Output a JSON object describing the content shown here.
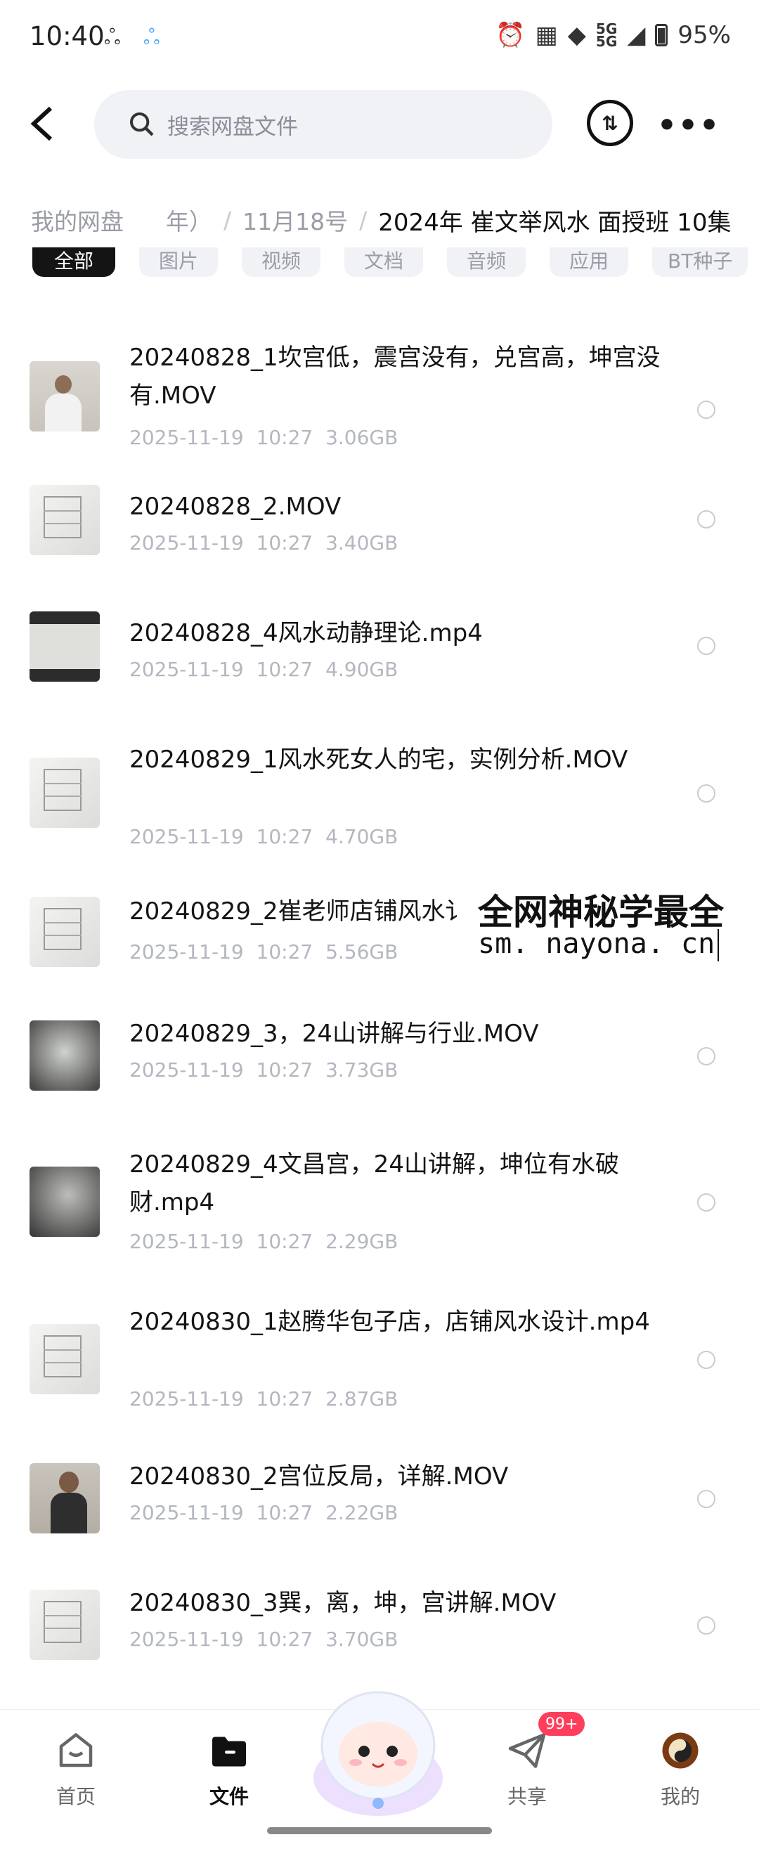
{
  "status_bar": {
    "time": "10:40",
    "signal": "5G",
    "battery": "95%"
  },
  "nav": {
    "search_placeholder": "搜索网盘文件"
  },
  "breadcrumb": {
    "root": "我的网盘",
    "partial": "年）",
    "middle": "11月18号",
    "current": "2024年 崔文举风水 面授班 10集"
  },
  "filters": [
    "全部",
    "图片",
    "视频",
    "文档",
    "音频",
    "应用",
    "BT种子"
  ],
  "files": [
    {
      "name": "20240828_1坎宫低，震宫没有，兑宫高，坤宫没有.MOV",
      "date": "2025-11-19",
      "time": "10:27",
      "size": "3.06GB",
      "thumb": "person"
    },
    {
      "name": "20240828_2.MOV",
      "date": "2025-11-19",
      "time": "10:27",
      "size": "3.40GB",
      "thumb": "board"
    },
    {
      "name": "20240828_4风水动静理论.mp4",
      "date": "2025-11-19",
      "time": "10:27",
      "size": "4.90GB",
      "thumb": "dark"
    },
    {
      "name": "20240829_1风水死女人的宅，实例分析.MOV",
      "date": "2025-11-19",
      "time": "10:27",
      "size": "4.70GB",
      "thumb": "board"
    },
    {
      "name": "20240829_2崔老师店铺风水讠",
      "date": "2025-11-19",
      "time": "10:27",
      "size": "5.56GB",
      "thumb": "board"
    },
    {
      "name": "20240829_3，24山讲解与行业.MOV",
      "date": "2025-11-19",
      "time": "10:27",
      "size": "3.73GB",
      "thumb": "blur"
    },
    {
      "name": "20240829_4文昌宫，24山讲解，坤位有水破财.mp4",
      "date": "2025-11-19",
      "time": "10:27",
      "size": "2.29GB",
      "thumb": "blur2"
    },
    {
      "name": "20240830_1赵腾华包子店，店铺风水设计.mp4",
      "date": "2025-11-19",
      "time": "10:27",
      "size": "2.87GB",
      "thumb": "board"
    },
    {
      "name": "20240830_2宫位反局，详解.MOV",
      "date": "2025-11-19",
      "time": "10:27",
      "size": "2.22GB",
      "thumb": "person2"
    },
    {
      "name": "20240830_3巽，离，坤，宫讲解.MOV",
      "date": "2025-11-19",
      "time": "10:27",
      "size": "3.70GB",
      "thumb": "board"
    }
  ],
  "watermark": {
    "title": "全网神秘学最全",
    "url": "sm. nayona. cn"
  },
  "tabbar": {
    "home": "首页",
    "files": "文件",
    "share": "共享",
    "mine": "我的",
    "badge": "99+"
  }
}
